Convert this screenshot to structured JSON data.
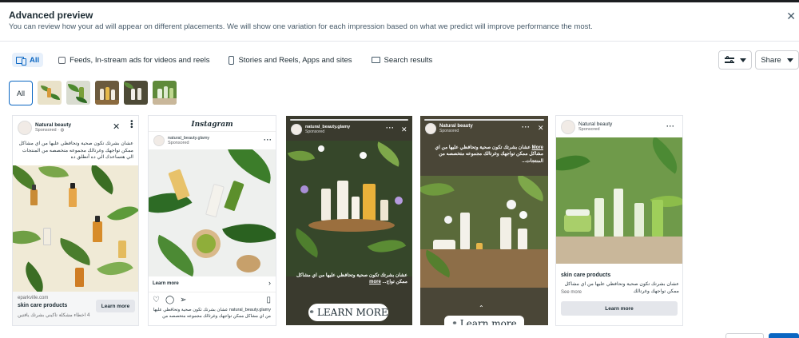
{
  "dialog": {
    "title": "Advanced preview",
    "subtitle": "You can review how your ad will appear on different placements. We will show one variation for each impression based on what we predict will improve performance the most.",
    "close_icon": "close-icon"
  },
  "filters": {
    "all": "All",
    "feeds": "Feeds, In-stream ads for videos and reels",
    "stories": "Stories and Reels, Apps and sites",
    "search": "Search results"
  },
  "toolbar": {
    "share_label": "Share"
  },
  "thumbnails": {
    "all_label": "All"
  },
  "colors": {
    "accent": "#0a66c2",
    "leaf": "#3f7d2a",
    "dark": "#2a2a28"
  },
  "cards": {
    "facebook": {
      "page_name": "Natural beauty",
      "sponsored": "Sponsored · ",
      "primary_text": "عشان بشرتك تكون صحية وتحافظي عليها من اي مشاكل ممكن تواجهك وغرتالك مجموعه متخصصه من المنتجات الي هتساعدك الي ده أتطلق ده",
      "domain": "eparkville.com",
      "headline": "skin care products",
      "description": "4 اخطاء مشكلة تاكيني بشرتك يافتين",
      "cta": "Learn more"
    },
    "instagram": {
      "app_title": "Instagram",
      "handle": "natural_beauty.glamy",
      "sponsored": "Sponsored",
      "cta": "Learn more",
      "caption": "natural_beauty.glamy عشان بشرتك تكون صحية وتحافظي عليها من اي مشاكل ممكن تواجهك وغرتالك مجموعه متخصصه من"
    },
    "ig_story": {
      "handle": "natural_beauty.glamy",
      "sponsored": "Sponsored",
      "text": "عشان بشرتك تكون صحية وتحافظي عليها من اي مشاكل ممكن تواج...",
      "more": "more",
      "cta": "LEARN MORE"
    },
    "fb_story": {
      "page_name": "Natural beauty",
      "sponsored": "Sponsored",
      "text": "عشان بشرتك تكون صحية وتحافظي عليها من اي مشاكل ممكن تواجهك وغرتالك مجموعه متخصصه من المنتجات...",
      "more": "More",
      "cta": "Learn more"
    },
    "fb_feed2": {
      "page_name": "Natural beauty",
      "sponsored": "Sponsored",
      "headline": "skin care products",
      "text": "عشان بشرتك تكون صحية وتحافظي عليها من اي مشاكل ممكن تواجهك وغرتالك",
      "see_more": "See more",
      "cta": "Learn more"
    }
  }
}
